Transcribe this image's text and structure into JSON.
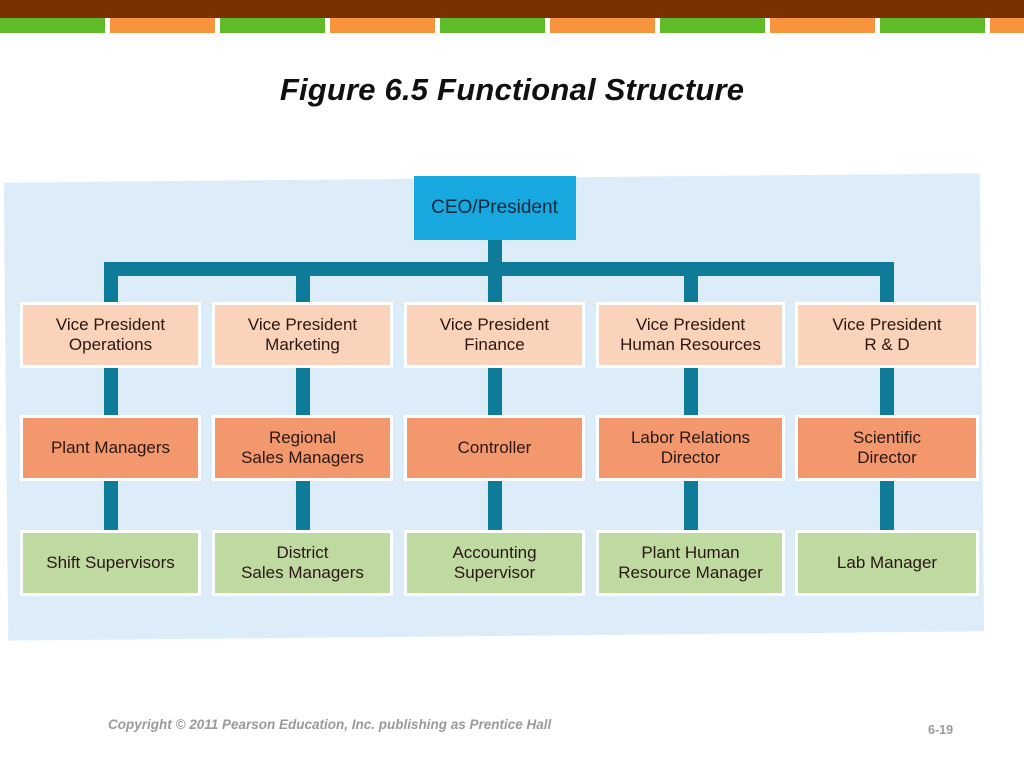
{
  "slide": {
    "title": "Figure 6.5 Functional Structure",
    "page_number": "6-19",
    "copyright": "Copyright © 2011 Pearson Education, Inc. publishing as Prentice Hall"
  },
  "colors": {
    "banner_brown": "#7B3000",
    "stripe_green": "#5FBB28",
    "stripe_orange": "#F7943E",
    "backdrop_blue": "#DCEDF9",
    "connector_teal": "#0E7B99",
    "ceo_blue": "#17A8DF",
    "vp_peach": "#FAD3BA",
    "mid_orange": "#F2986C",
    "bottom_green": "#BEDAA0",
    "footer_gray": "#9A9A9A"
  },
  "top_banner": {
    "stripes": [
      "green",
      "orange",
      "green",
      "orange",
      "green",
      "orange",
      "green",
      "orange",
      "green",
      "orange"
    ]
  },
  "chart_data": {
    "type": "diagram",
    "diagram_type": "organizational-chart",
    "title": "Figure 6.5 Functional Structure",
    "levels": 4,
    "root": {
      "id": "ceo",
      "label": "CEO/President",
      "level": 0,
      "color": "#17A8DF"
    },
    "columns": [
      {
        "id": "operations",
        "vp": {
          "label": "Vice President\nOperations",
          "level": 1,
          "color": "#FAD3BA"
        },
        "middle": {
          "label": "Plant Managers",
          "level": 2,
          "color": "#F2986C"
        },
        "bottom": {
          "label": "Shift Supervisors",
          "level": 3,
          "color": "#BEDAA0"
        }
      },
      {
        "id": "marketing",
        "vp": {
          "label": "Vice President\nMarketing",
          "level": 1,
          "color": "#FAD3BA"
        },
        "middle": {
          "label": "Regional\nSales Managers",
          "level": 2,
          "color": "#F2986C"
        },
        "bottom": {
          "label": "District\nSales Managers",
          "level": 3,
          "color": "#BEDAA0"
        }
      },
      {
        "id": "finance",
        "vp": {
          "label": "Vice President\nFinance",
          "level": 1,
          "color": "#FAD3BA"
        },
        "middle": {
          "label": "Controller",
          "level": 2,
          "color": "#F2986C"
        },
        "bottom": {
          "label": "Accounting\nSupervisor",
          "level": 3,
          "color": "#BEDAA0"
        }
      },
      {
        "id": "human-resources",
        "vp": {
          "label": "Vice President\nHuman Resources",
          "level": 1,
          "color": "#FAD3BA"
        },
        "middle": {
          "label": "Labor Relations\nDirector",
          "level": 2,
          "color": "#F2986C"
        },
        "bottom": {
          "label": "Plant Human\nResource Manager",
          "level": 3,
          "color": "#BEDAA0"
        }
      },
      {
        "id": "research-development",
        "vp": {
          "label": "Vice President\nR & D",
          "level": 1,
          "color": "#FAD3BA"
        },
        "middle": {
          "label": "Scientific\nDirector",
          "level": 2,
          "color": "#F2986C"
        },
        "bottom": {
          "label": "Lab Manager",
          "level": 3,
          "color": "#BEDAA0"
        }
      }
    ]
  }
}
